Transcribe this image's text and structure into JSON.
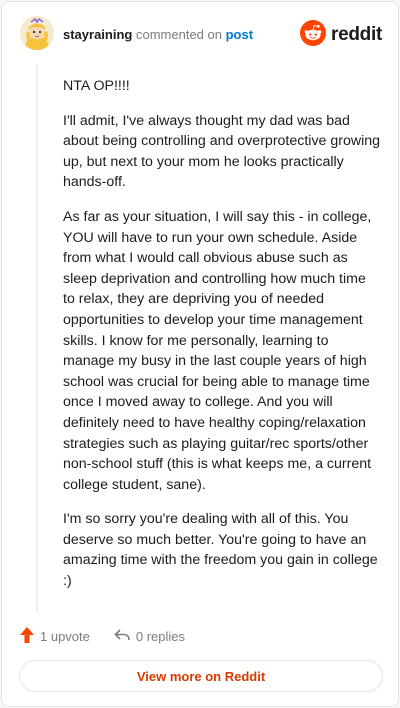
{
  "comment": {
    "username": "stayraining",
    "commented_on_text": "commented on",
    "post_link": "post",
    "paragraphs": [
      "NTA OP!!!!",
      "I'll admit, I've always thought my dad was bad about being controlling and overprotective growing up, but next to your mom he looks practically hands-off.",
      "As far as your situation, I will say this - in college, YOU will have to run your own schedule. Aside from what I would call obvious abuse such as sleep deprivation and controlling how much time to relax, they are depriving you of needed opportunities to develop your time management skills. I know for me personally, learning to manage my busy in the last couple years of high school was crucial for being able to manage time once I moved away to college. And you will definitely need to have healthy coping/relaxation strategies such as playing guitar/rec sports/other non-school stuff (this is what keeps me, a current college student, sane).",
      "I'm so sorry you're dealing with all of this. You deserve so much better. You're going to have an amazing time with the freedom you gain in college :)"
    ]
  },
  "brand": {
    "name": "reddit",
    "icon": "reddit-logo-icon",
    "color": "#ff4500"
  },
  "actions": {
    "upvotes": "1 upvote",
    "replies": "0 replies",
    "upvote_icon": "upvote-arrow-icon",
    "reply_icon": "reply-arrow-icon",
    "upvote_color": "#ff4500"
  },
  "footer": {
    "view_more": "View more on Reddit",
    "color": "#d93a00"
  }
}
